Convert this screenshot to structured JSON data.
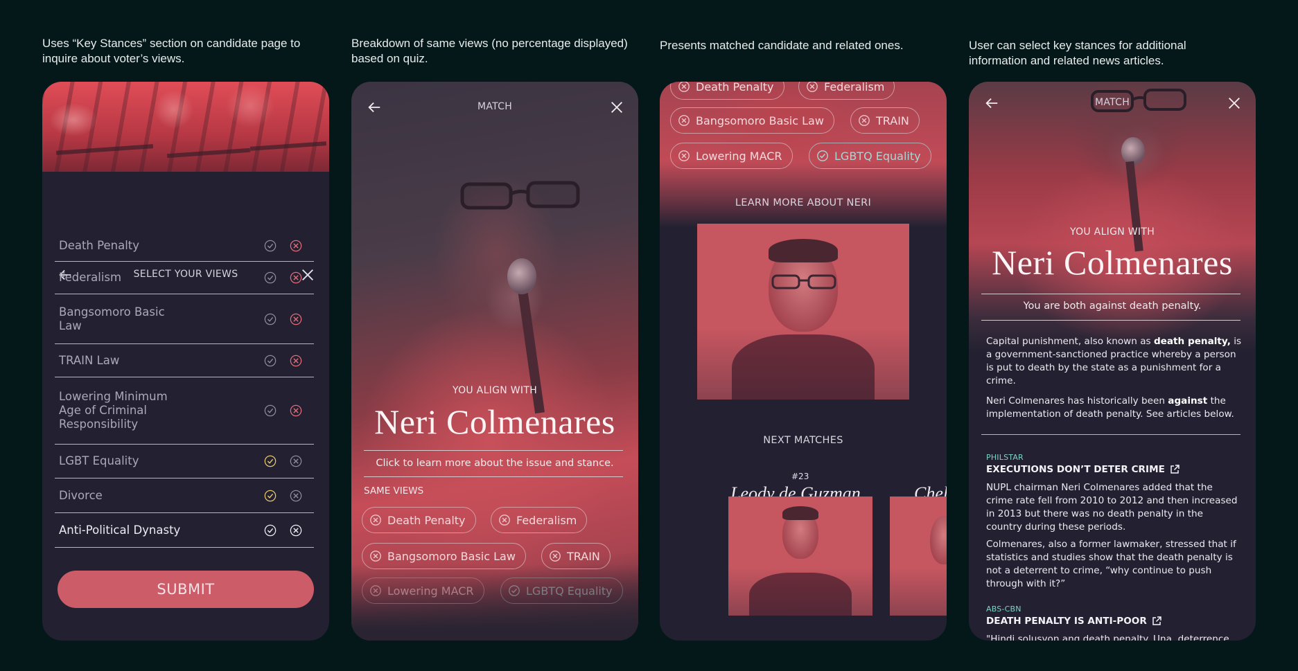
{
  "captions": [
    "Uses “Key Stances” section on candidate page to inquire about voter’s views.",
    "Breakdown of same views (no percentage displayed) based on quiz.",
    "Presents matched candidate and related ones.",
    "User can select key stances for additional information and related news articles."
  ],
  "screen1": {
    "title": "SELECT YOUR VIEWS",
    "views": [
      {
        "label": "Death Penalty",
        "state": "against"
      },
      {
        "label": "Federalism",
        "state": "against"
      },
      {
        "label": "Bangsomoro Basic Law",
        "state": "against"
      },
      {
        "label": "TRAIN Law",
        "state": "against"
      },
      {
        "label": "Lowering  Minimum Age of Criminal Responsibility",
        "state": "against"
      },
      {
        "label": "LGBT Equality",
        "state": "for"
      },
      {
        "label": "Divorce",
        "state": "for"
      },
      {
        "label": "Anti-Political Dynasty",
        "state": "none"
      }
    ],
    "submit_label": "SUBMIT"
  },
  "screen2": {
    "title": "MATCH",
    "align_label": "YOU ALIGN WITH",
    "candidate": "Neri Colmenares",
    "note": "Click to learn more about the issue and stance.",
    "same_views_label": "SAME VIEWS",
    "pills": [
      "Death Penalty",
      "Federalism",
      "Bangsomoro Basic Law",
      "TRAIN",
      "Lowering MACR",
      "LGBTQ Equality"
    ]
  },
  "screen3": {
    "pills": [
      "Death Penalty",
      "Federalism",
      "Bangsomoro Basic Law",
      "TRAIN",
      "Lowering MACR",
      "LGBTQ Equality"
    ],
    "learn_more": "LEARN MORE ABOUT NERI",
    "next_matches": "NEXT MATCHES",
    "matches": [
      {
        "rank": "#23",
        "name": "Leody de Guzman"
      },
      {
        "rank": "",
        "name": "Chel"
      }
    ]
  },
  "screen4": {
    "title": "MATCH",
    "align_label": "YOU ALIGN WITH",
    "candidate": "Neri Colmenares",
    "summary": "You are both against death penalty.",
    "def_pre": "Capital punishment, also known as ",
    "def_bold": "death penalty,",
    "def_post": " is a government-sanctioned practice whereby a person is put to death by the state as a punishment for a crime.",
    "stance_pre": "Neri Colmenares has historically been ",
    "stance_bold": "against",
    "stance_post": " the implementation of death penalty. See articles below.",
    "articles": [
      {
        "source": "PHILSTAR",
        "headline": "EXECUTIONS DON’T DETER CRIME",
        "paragraphs": [
          "NUPL chairman Neri Colmenares added that the crime rate fell from 2010 to 2012 and then increased in 2013 but there was no death penalty in the country during these periods.",
          "Colmenares, also a former lawmaker, stressed that if statistics and studies show that the death penalty is not a deterrent to crime, “why continue to push through with it?”"
        ]
      },
      {
        "source": "ABS-CBN",
        "headline": "DEATH PENALTY IS ANTI-POOR",
        "paragraphs": [
          "\"Hindi solusyon ang death penalty. Una, deterrence"
        ]
      }
    ]
  },
  "colors": {
    "background": "#04181a",
    "panel": "#232131",
    "accent": "#cc5c68",
    "teal": "#7fd3c8",
    "check_yellow": "#e6c86a",
    "x_red": "#e26b78"
  }
}
